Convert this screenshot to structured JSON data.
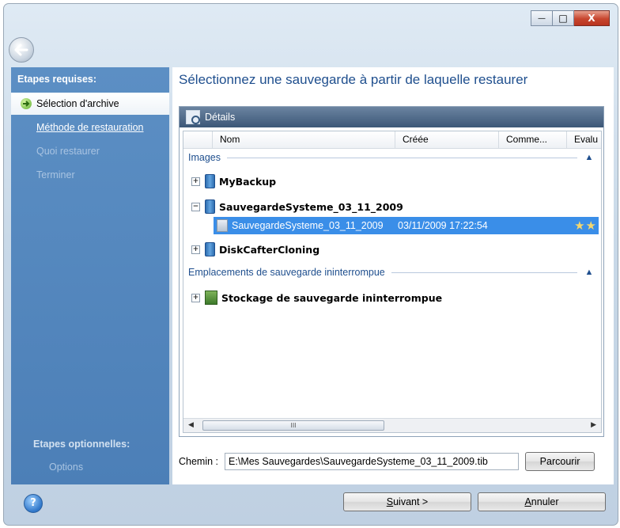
{
  "window": {
    "minimize_symbol": "—",
    "maximize_symbol": "□",
    "close_symbol": "X"
  },
  "sidebar": {
    "required_heading": "Etapes requises:",
    "steps": [
      {
        "label": "Sélection d'archive",
        "state": "active"
      },
      {
        "label": "Méthode de restauration",
        "state": "link"
      },
      {
        "label": "Quoi restaurer",
        "state": "disabled"
      },
      {
        "label": "Terminer",
        "state": "disabled"
      }
    ],
    "optional_heading": "Etapes optionnelles:",
    "optional_steps": [
      "Options"
    ]
  },
  "main": {
    "heading": "Sélectionnez une sauvegarde à partir de laquelle restaurer",
    "panel_title": "Détails",
    "columns": [
      "Nom",
      "Créée",
      "Comme...",
      "Evalu"
    ],
    "groups": [
      {
        "label": "Images",
        "items": [
          {
            "name": "MyBackup",
            "expanded": false
          },
          {
            "name": "SauvegardeSysteme_03_11_2009",
            "expanded": true
          },
          {
            "name": "DiskCafterCloning",
            "expanded": false
          }
        ]
      },
      {
        "label": "Emplacements de sauvegarde ininterrompue",
        "items": [
          {
            "name": "Stockage de sauvegarde ininterrompue",
            "expanded": false
          }
        ]
      }
    ],
    "selected_row": {
      "name": "SauvegardeSysteme_03_11_2009",
      "created": "03/11/2009 17:22:54",
      "stars": "★★"
    },
    "scroll_thumb_grip": "III",
    "path_label": "Chemin :",
    "path_value": "E:\\Mes Sauvegardes\\SauvegardeSysteme_03_11_2009.tib",
    "browse_button": "Parcourir"
  },
  "footer": {
    "help_symbol": "?",
    "next_button_key": "S",
    "next_button_rest": "uivant >",
    "cancel_button_key": "A",
    "cancel_button_rest": "nnuler"
  },
  "colors": {
    "sidebar": "#4c7fb7",
    "heading": "#1f4f8e",
    "selection": "#3a8ee8"
  }
}
